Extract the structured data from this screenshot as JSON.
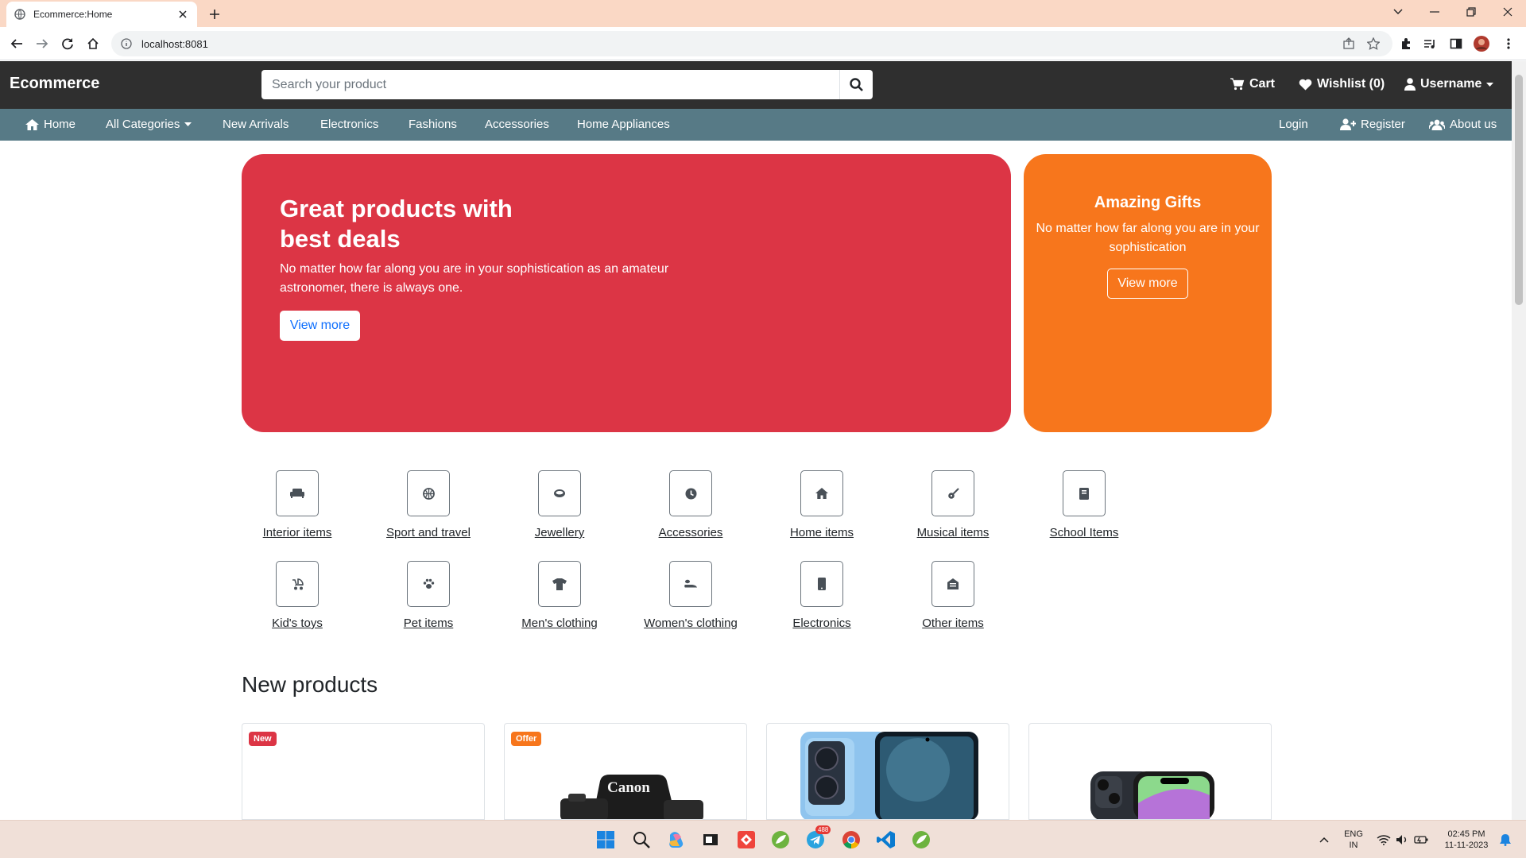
{
  "browser": {
    "tab_title": "Ecommerce:Home",
    "url": "localhost:8081"
  },
  "header": {
    "brand": "Ecommerce",
    "search_placeholder": "Search your product",
    "cart_label": "Cart",
    "wishlist_label": "Wishlist (0)",
    "user_label": "Username"
  },
  "nav": {
    "home": "Home",
    "all_categories": "All Categories",
    "new_arrivals": "New Arrivals",
    "electronics": "Electronics",
    "fashions": "Fashions",
    "accessories": "Accessories",
    "home_appliances": "Home Appliances",
    "login": "Login",
    "register": "Register",
    "about": "About us"
  },
  "hero": {
    "title": "Great products with best deals",
    "text": "No matter how far along you are in your sophistication as an amateur astronomer, there is always one.",
    "button": "View more"
  },
  "gift": {
    "title": "Amazing Gifts",
    "text": "No matter how far along you are in your sophistication",
    "button": "View more"
  },
  "categories": {
    "row1": [
      "Interior items",
      "Sport and travel",
      "Jewellery",
      "Accessories",
      "Home items",
      "Musical items",
      "School Items"
    ],
    "row2": [
      "Kid's toys",
      "Pet items",
      "Men's clothing",
      "Women's clothing",
      "Electronics",
      "Other items"
    ]
  },
  "new_products": {
    "title": "New products",
    "badges": [
      "New",
      "Offer"
    ],
    "camera_brand": "Canon"
  },
  "taskbar": {
    "lang": "ENG",
    "region": "IN",
    "time": "02:45 PM",
    "date": "11-11-2023",
    "telegram_count": "488"
  },
  "colors": {
    "hero_red": "#dc3545",
    "gift_orange": "#f7761c",
    "header_dark": "#2f2f2f",
    "nav_teal": "#577a86",
    "badge_new": "#dc3545",
    "badge_offer": "#f7761c"
  }
}
